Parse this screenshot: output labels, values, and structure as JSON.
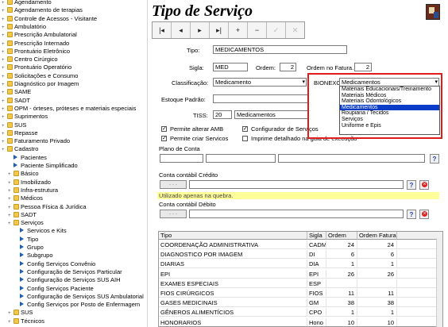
{
  "tree": [
    {
      "label": "Agendamento",
      "icon": "folder",
      "indent": 0
    },
    {
      "label": "Agendamento de terapias",
      "icon": "folder",
      "indent": 0
    },
    {
      "label": "Controle de Acessos - Visitante",
      "icon": "folder",
      "indent": 0
    },
    {
      "label": "Ambulatório",
      "icon": "folder",
      "indent": 0
    },
    {
      "label": "Prescrição Ambulatorial",
      "icon": "folder",
      "indent": 0
    },
    {
      "label": "Prescrição Internado",
      "icon": "folder",
      "indent": 0
    },
    {
      "label": "Prontuário Eletrônico",
      "icon": "folder",
      "indent": 0
    },
    {
      "label": "Centro Cirúrgico",
      "icon": "folder",
      "indent": 0
    },
    {
      "label": "Prontuário Operatório",
      "icon": "folder",
      "indent": 0
    },
    {
      "label": "Solicitações e Consumo",
      "icon": "folder",
      "indent": 0
    },
    {
      "label": "Diagnóstico por Imagem",
      "icon": "folder",
      "indent": 0
    },
    {
      "label": "SAME",
      "icon": "folder",
      "indent": 0
    },
    {
      "label": "SADT",
      "icon": "folder",
      "indent": 0
    },
    {
      "label": "OPM - órteses, próteses e materiais especiais",
      "icon": "folder",
      "indent": 0
    },
    {
      "label": "Suprimentos",
      "icon": "folder",
      "indent": 0
    },
    {
      "label": "SUS",
      "icon": "folder",
      "indent": 0
    },
    {
      "label": "Repasse",
      "icon": "folder",
      "indent": 0
    },
    {
      "label": "Faturamento Privado",
      "icon": "folder",
      "indent": 0
    },
    {
      "label": "Cadastro",
      "icon": "folder",
      "indent": 0
    },
    {
      "label": "Pacientes",
      "icon": "arrow",
      "indent": 1
    },
    {
      "label": "Paciente Simplificado",
      "icon": "arrow",
      "indent": 1
    },
    {
      "label": "Básico",
      "icon": "folder",
      "indent": 1
    },
    {
      "label": "Imobilizado",
      "icon": "folder",
      "indent": 1
    },
    {
      "label": "Infra-estrutura",
      "icon": "folder",
      "indent": 1
    },
    {
      "label": "Médicos",
      "icon": "folder",
      "indent": 1
    },
    {
      "label": "Pessoa Física & Jurídica",
      "icon": "folder",
      "indent": 1
    },
    {
      "label": "SADT",
      "icon": "folder",
      "indent": 1
    },
    {
      "label": "Serviços",
      "icon": "folder",
      "indent": 1
    },
    {
      "label": "Servicos e Kits",
      "icon": "arrow",
      "indent": 2
    },
    {
      "label": "Tipo",
      "icon": "arrow",
      "indent": 2
    },
    {
      "label": "Grupo",
      "icon": "arrow",
      "indent": 2
    },
    {
      "label": "Subgrupo",
      "icon": "arrow",
      "indent": 2
    },
    {
      "label": "Config Serviços Convênio",
      "icon": "arrow",
      "indent": 2
    },
    {
      "label": "Configuração de Serviços Particular",
      "icon": "arrow",
      "indent": 2
    },
    {
      "label": "Configuração de Serviços SUS AIH",
      "icon": "arrow",
      "indent": 2
    },
    {
      "label": "Config Serviços Paciente",
      "icon": "arrow",
      "indent": 2
    },
    {
      "label": "Configuração de Serviços SUS Ambulatorial",
      "icon": "arrow",
      "indent": 2
    },
    {
      "label": "Config Serviços por Posto de Enfermagem",
      "icon": "arrow",
      "indent": 2
    },
    {
      "label": "SUS",
      "icon": "folder",
      "indent": 1
    },
    {
      "label": "Técnicos",
      "icon": "folder",
      "indent": 1
    }
  ],
  "title": "Tipo de Serviço",
  "toolbar": [
    "|◂",
    "◂",
    "▸",
    "▸|",
    "+",
    "−",
    "✓",
    "✕"
  ],
  "form": {
    "tipo_label": "Tipo:",
    "tipo_value": "MEDICAMENTOS",
    "sigla_label": "Sigla:",
    "sigla_value": "MED",
    "ordem_label": "Ordem:",
    "ordem_value": "2",
    "ordem_fatura_label": "Ordem no Fatura.:",
    "ordem_fatura_value": "2",
    "classificacao_label": "Classificação:",
    "classificacao_value": "Medicamento",
    "bionexo_label": "BIONEXO:",
    "bionexo_value": "Medicamentos",
    "estoque_label": "Estoque Padrão:",
    "tiss_label": "TISS:",
    "tiss_code": "20",
    "tiss_value": "Medicamentos",
    "cb_amb": "Permite alterar AMB",
    "cb_config": "Configurador de Serviços",
    "cb_criar": "Permite criar Servicos",
    "cb_imprime": "Imprime detalhado na guia de execução",
    "plano_label": "Plano de Conta",
    "credito_label": "Conta contábil Crédito",
    "credito_dots": ". . .",
    "quebra_note": "Utilizado apenas na quebra.",
    "debito_label": "Conta contábil Débito",
    "debito_dots": ". . .",
    "help": "?"
  },
  "dropdown": {
    "options": [
      "Materiais Educacionais/Treinamento",
      "Materiais Médicos",
      "Materiais Odontológicos",
      "Medicamentos",
      "Roupiaria / Tecidos",
      "Serviços",
      "Uniforme e Epis"
    ],
    "selected": "Medicamentos"
  },
  "table": {
    "headers": [
      "Tipo",
      "Sigla",
      "Ordem",
      "Ordem Fatura"
    ],
    "rows": [
      [
        "COORDENAÇÃO ADMINISTRATIVA",
        "CADM",
        "24",
        "24"
      ],
      [
        "DIAGNOSTICO POR IMAGEM",
        "DI",
        "6",
        "6"
      ],
      [
        "DIARIAS",
        "DIA",
        "1",
        "1"
      ],
      [
        "EPI",
        "EPI",
        "26",
        "26"
      ],
      [
        "EXAMES ESPECIAIS",
        "ESP",
        "",
        ""
      ],
      [
        "FIOS CIRÚRGICOS",
        "FIOS",
        "11",
        "11"
      ],
      [
        "GASES MEDICINAIS",
        "GM",
        "38",
        "38"
      ],
      [
        "GÊNEROS ALIMENTÍCIOS",
        "CPO",
        "1",
        "1"
      ],
      [
        "HONORARIOS",
        "Hono",
        "10",
        "10"
      ]
    ]
  },
  "colors": {
    "highlight": "#0a3cc8",
    "redbox": "#e01b1b",
    "note_bg": "#ffff99"
  }
}
